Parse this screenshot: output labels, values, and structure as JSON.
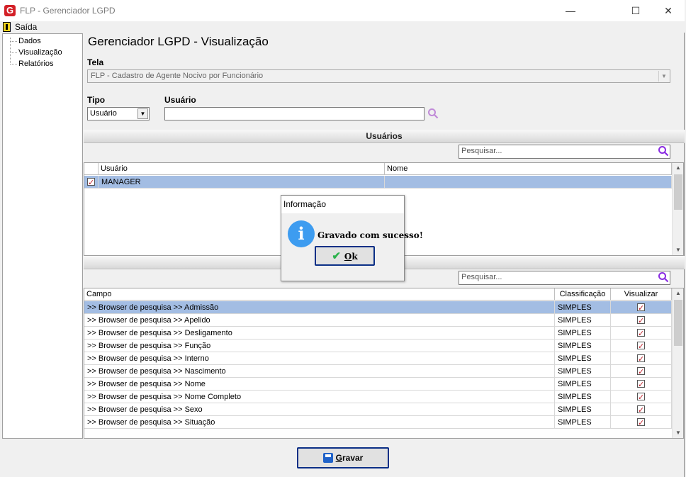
{
  "window": {
    "title": "FLP - Gerenciador LGPD",
    "icon": "app-logo-icon"
  },
  "menu": {
    "exit_label": "Saída"
  },
  "sidebar": {
    "items": [
      {
        "label": "Dados"
      },
      {
        "label": "Visualização"
      },
      {
        "label": "Relatórios"
      }
    ]
  },
  "page": {
    "title": "Gerenciador LGPD - Visualização"
  },
  "form": {
    "tela_label": "Tela",
    "tela_value": "FLP - Cadastro de Agente Nocivo por Funcionário",
    "tipo_label": "Tipo",
    "tipo_value": "Usuário",
    "usuario_label": "Usuário",
    "usuario_value": ""
  },
  "users_section": {
    "title": "Usuários",
    "search_placeholder": "Pesquisar...",
    "columns": [
      "Usuário",
      "Nome"
    ],
    "rows": [
      {
        "usuario": "MANAGER",
        "nome": "",
        "checked": true
      }
    ]
  },
  "fields_section": {
    "search_placeholder": "Pesquisar...",
    "columns": [
      "Campo",
      "Classificação",
      "Visualizar"
    ],
    "rows": [
      {
        "campo": ">> Browser de pesquisa >> Admissão",
        "classificacao": "SIMPLES",
        "visualizar": true
      },
      {
        "campo": ">> Browser de pesquisa >> Apelido",
        "classificacao": "SIMPLES",
        "visualizar": true
      },
      {
        "campo": ">> Browser de pesquisa >> Desligamento",
        "classificacao": "SIMPLES",
        "visualizar": true
      },
      {
        "campo": ">> Browser de pesquisa >> Função",
        "classificacao": "SIMPLES",
        "visualizar": true
      },
      {
        "campo": ">> Browser de pesquisa >> Interno",
        "classificacao": "SIMPLES",
        "visualizar": true
      },
      {
        "campo": ">> Browser de pesquisa >> Nascimento",
        "classificacao": "SIMPLES",
        "visualizar": true
      },
      {
        "campo": ">> Browser de pesquisa >> Nome",
        "classificacao": "SIMPLES",
        "visualizar": true
      },
      {
        "campo": ">> Browser de pesquisa >> Nome Completo",
        "classificacao": "SIMPLES",
        "visualizar": true
      },
      {
        "campo": ">> Browser de pesquisa >> Sexo",
        "classificacao": "SIMPLES",
        "visualizar": true
      },
      {
        "campo": ">> Browser de pesquisa >> Situação",
        "classificacao": "SIMPLES",
        "visualizar": true
      }
    ]
  },
  "footer": {
    "save_label_prefix": "",
    "save_label_hotkey": "G",
    "save_label_rest": "ravar"
  },
  "dialog": {
    "title": "Informação",
    "message": "Gravado com sucesso!",
    "ok_hotkey": "O",
    "ok_rest": "k"
  },
  "colors": {
    "selection": "#a3bde3",
    "accent_border": "#0b2f86",
    "search_icon": "#8a2be2",
    "info_icon": "#3d9cf0",
    "check": "#c0202a"
  }
}
